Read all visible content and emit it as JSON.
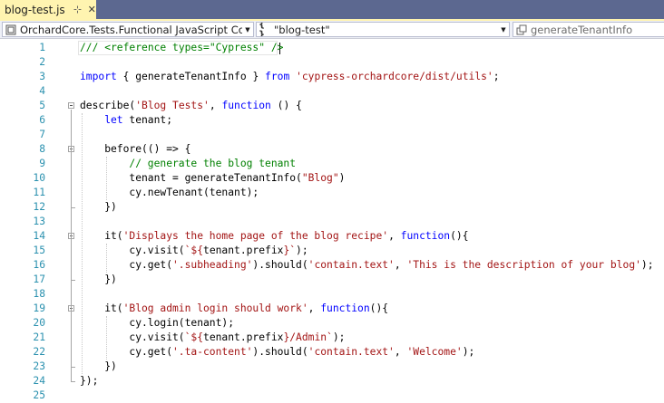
{
  "tab": {
    "title": "blog-test.js",
    "pin_glyph": "⊹",
    "close_glyph": "✕"
  },
  "navbar": {
    "project": "OrchardCore.Tests.Functional JavaScript Conte",
    "scope": "\"blog-test\"",
    "member": "generateTenantInfo"
  },
  "colors": {
    "keyword": "#0000ff",
    "string": "#a31515",
    "comment": "#008000",
    "line_number": "#2b91af",
    "tab_active": "#fff4b0",
    "tabstrip": "#5c6890"
  },
  "editor": {
    "lines": [
      {
        "n": "1",
        "indent": 0,
        "tokens": [
          [
            "c",
            "/// <reference types=\"Cypress\" />"
          ]
        ]
      },
      {
        "n": "2",
        "indent": 0,
        "tokens": []
      },
      {
        "n": "3",
        "indent": 0,
        "tokens": [
          [
            "k",
            "import"
          ],
          [
            "p",
            " { generateTenantInfo } "
          ],
          [
            "k",
            "from"
          ],
          [
            "p",
            " "
          ],
          [
            "s",
            "'cypress-orchardcore/dist/utils'"
          ],
          [
            "p",
            ";"
          ]
        ]
      },
      {
        "n": "4",
        "indent": 0,
        "tokens": []
      },
      {
        "n": "5",
        "indent": 0,
        "fold": true,
        "tokens": [
          [
            "p",
            "describe("
          ],
          [
            "s",
            "'Blog Tests'"
          ],
          [
            "p",
            ", "
          ],
          [
            "k",
            "function"
          ],
          [
            "p",
            " () {"
          ]
        ]
      },
      {
        "n": "6",
        "indent": 1,
        "tokens": [
          [
            "k",
            "let"
          ],
          [
            "p",
            " tenant;"
          ]
        ]
      },
      {
        "n": "7",
        "indent": 0,
        "tokens": []
      },
      {
        "n": "8",
        "indent": 1,
        "fold": true,
        "tokens": [
          [
            "p",
            "before(() => {"
          ]
        ]
      },
      {
        "n": "9",
        "indent": 2,
        "tokens": [
          [
            "c",
            "// generate the blog tenant"
          ]
        ]
      },
      {
        "n": "10",
        "indent": 2,
        "tokens": [
          [
            "p",
            "tenant = generateTenantInfo("
          ],
          [
            "s",
            "\"Blog\""
          ],
          [
            "p",
            ")"
          ]
        ]
      },
      {
        "n": "11",
        "indent": 2,
        "tokens": [
          [
            "p",
            "cy.newTenant(tenant);"
          ]
        ]
      },
      {
        "n": "12",
        "indent": 1,
        "tokens": [
          [
            "p",
            "})"
          ]
        ]
      },
      {
        "n": "13",
        "indent": 0,
        "tokens": []
      },
      {
        "n": "14",
        "indent": 1,
        "fold": true,
        "tokens": [
          [
            "p",
            "it("
          ],
          [
            "s",
            "'Displays the home page of the blog recipe'"
          ],
          [
            "p",
            ", "
          ],
          [
            "k",
            "function"
          ],
          [
            "p",
            "(){"
          ]
        ]
      },
      {
        "n": "15",
        "indent": 2,
        "tokens": [
          [
            "p",
            "cy.visit("
          ],
          [
            "s",
            "`${"
          ],
          [
            "p",
            "tenant.prefix"
          ],
          [
            "s",
            "}`"
          ],
          [
            "p",
            ");"
          ]
        ]
      },
      {
        "n": "16",
        "indent": 2,
        "tokens": [
          [
            "p",
            "cy.get("
          ],
          [
            "s",
            "'.subheading'"
          ],
          [
            "p",
            ").should("
          ],
          [
            "s",
            "'contain.text'"
          ],
          [
            "p",
            ", "
          ],
          [
            "s",
            "'This is the description of your blog'"
          ],
          [
            "p",
            ");"
          ]
        ]
      },
      {
        "n": "17",
        "indent": 1,
        "tokens": [
          [
            "p",
            "})"
          ]
        ]
      },
      {
        "n": "18",
        "indent": 0,
        "tokens": []
      },
      {
        "n": "19",
        "indent": 1,
        "fold": true,
        "tokens": [
          [
            "p",
            "it("
          ],
          [
            "s",
            "'Blog admin login should work'"
          ],
          [
            "p",
            ", "
          ],
          [
            "k",
            "function"
          ],
          [
            "p",
            "(){"
          ]
        ]
      },
      {
        "n": "20",
        "indent": 2,
        "tokens": [
          [
            "p",
            "cy.login(tenant);"
          ]
        ]
      },
      {
        "n": "21",
        "indent": 2,
        "tokens": [
          [
            "p",
            "cy.visit("
          ],
          [
            "s",
            "`${"
          ],
          [
            "p",
            "tenant.prefix"
          ],
          [
            "s",
            "}/Admin`"
          ],
          [
            "p",
            ");"
          ]
        ]
      },
      {
        "n": "22",
        "indent": 2,
        "tokens": [
          [
            "p",
            "cy.get("
          ],
          [
            "s",
            "'.ta-content'"
          ],
          [
            "p",
            ").should("
          ],
          [
            "s",
            "'contain.text'"
          ],
          [
            "p",
            ", "
          ],
          [
            "s",
            "'Welcome'"
          ],
          [
            "p",
            ");"
          ]
        ]
      },
      {
        "n": "23",
        "indent": 1,
        "tokens": [
          [
            "p",
            "})"
          ]
        ]
      },
      {
        "n": "24",
        "indent": 0,
        "tokens": [
          [
            "p",
            "});"
          ]
        ]
      },
      {
        "n": "25",
        "indent": 0,
        "tokens": []
      }
    ]
  }
}
